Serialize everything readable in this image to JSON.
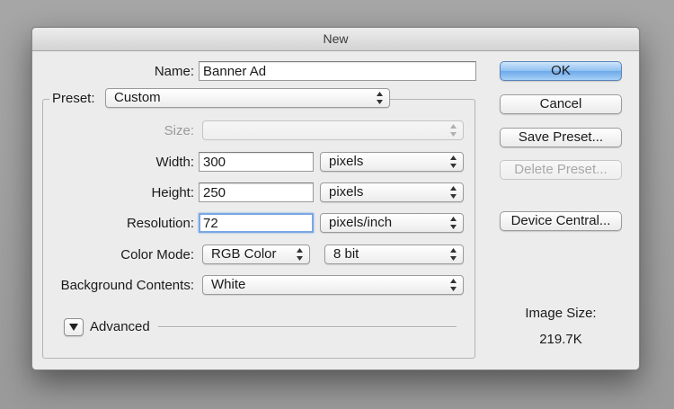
{
  "window": {
    "title": "New"
  },
  "name": {
    "label": "Name:",
    "value": "Banner Ad"
  },
  "preset": {
    "label": "Preset:",
    "value": "Custom"
  },
  "size": {
    "label": "Size:",
    "value": ""
  },
  "width": {
    "label": "Width:",
    "value": "300",
    "unit": "pixels"
  },
  "height": {
    "label": "Height:",
    "value": "250",
    "unit": "pixels"
  },
  "resolution": {
    "label": "Resolution:",
    "value": "72",
    "unit": "pixels/inch"
  },
  "color_mode": {
    "label": "Color Mode:",
    "mode": "RGB Color",
    "depth": "8 bit"
  },
  "background": {
    "label": "Background Contents:",
    "value": "White"
  },
  "advanced": {
    "label": "Advanced"
  },
  "buttons": {
    "ok": "OK",
    "cancel": "Cancel",
    "save_preset": "Save Preset...",
    "delete_preset": "Delete Preset...",
    "device_central": "Device Central..."
  },
  "image_size": {
    "label": "Image Size:",
    "value": "219.7K"
  },
  "icons": {
    "popup_arrows": "up-down-arrows-icon",
    "advanced_toggle": "triangle-down-icon"
  },
  "colors": {
    "accent": "#7aa7e3",
    "primary_button": "#8fc0f1"
  }
}
